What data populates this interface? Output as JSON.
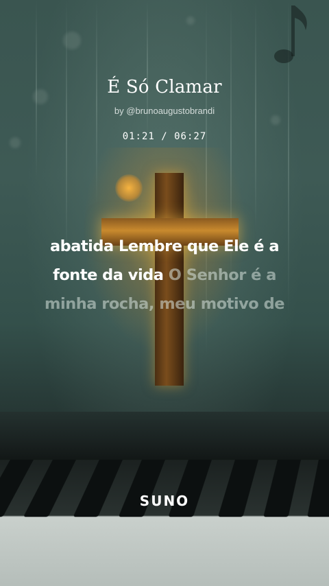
{
  "song": {
    "title": "É Só Clamar",
    "byline": "by @brunoaugustobrandi",
    "time": "01:21 / 06:27"
  },
  "lyrics": {
    "line1_sung": "abatida Lembre que Ele é a",
    "line2_sung": "fonte da vida",
    "line2_unsung": " O Senhor é a",
    "line3_unsung": "minha rocha, meu motivo de"
  },
  "brand": {
    "logo_text": "SUNO"
  },
  "icons": {
    "background_note": "music-note-icon",
    "background_cross": "cross-icon"
  },
  "colors": {
    "sung_text": "#ffffff",
    "unsung_text": "#b9c6c1",
    "cross_glow": "#f0aa28"
  }
}
